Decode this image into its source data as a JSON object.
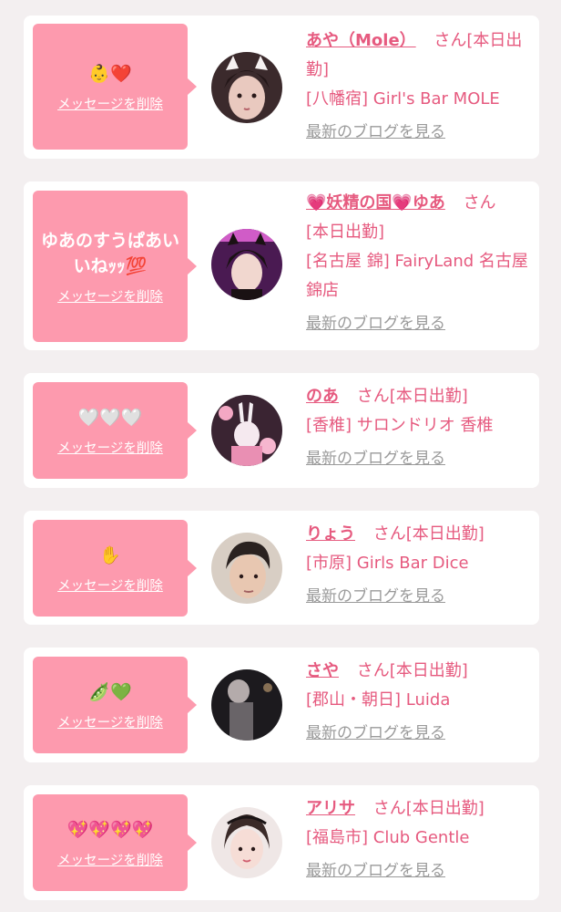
{
  "ui": {
    "delete_label": "メッセージを削除",
    "blog_label": "最新のブログを見る",
    "san_label": "さん",
    "shift_label": "[本日出勤]"
  },
  "cards": [
    {
      "message": "👶❤️",
      "name": "あや（Mole）",
      "shop": "[八幡宿] Girl's Bar MOLE",
      "avatar_icon": "girl-cat-ears-portrait"
    },
    {
      "message": "ゆあのすうぱあいいねｯｯ💯",
      "name": "💗妖精の国💗ゆあ",
      "shop": "[名古屋 錦] FairyLand 名古屋錦店",
      "avatar_icon": "girl-cat-ears-neon-portrait"
    },
    {
      "message": "🤍🤍🤍",
      "name": "のあ",
      "shop": "[香椎] サロンドリオ 香椎",
      "avatar_icon": "bunny-pink-portrait"
    },
    {
      "message": "✋",
      "name": "りょう",
      "shop": "[市原] Girls Bar Dice",
      "avatar_icon": "boy-portrait"
    },
    {
      "message": "🫛💚",
      "name": "さや",
      "shop": "[郡山・朝日] Luida",
      "avatar_icon": "dark-blurred-portrait"
    },
    {
      "message": "💖💖💖💖",
      "name": "アリサ",
      "shop": "[福島市] Club Gentle",
      "avatar_icon": "girl-lace-portrait"
    }
  ],
  "colors": {
    "accent": "#e65a7f",
    "bubble": "#fd9aae",
    "background": "#f3eff0",
    "blog_link": "#9a9a9a"
  }
}
